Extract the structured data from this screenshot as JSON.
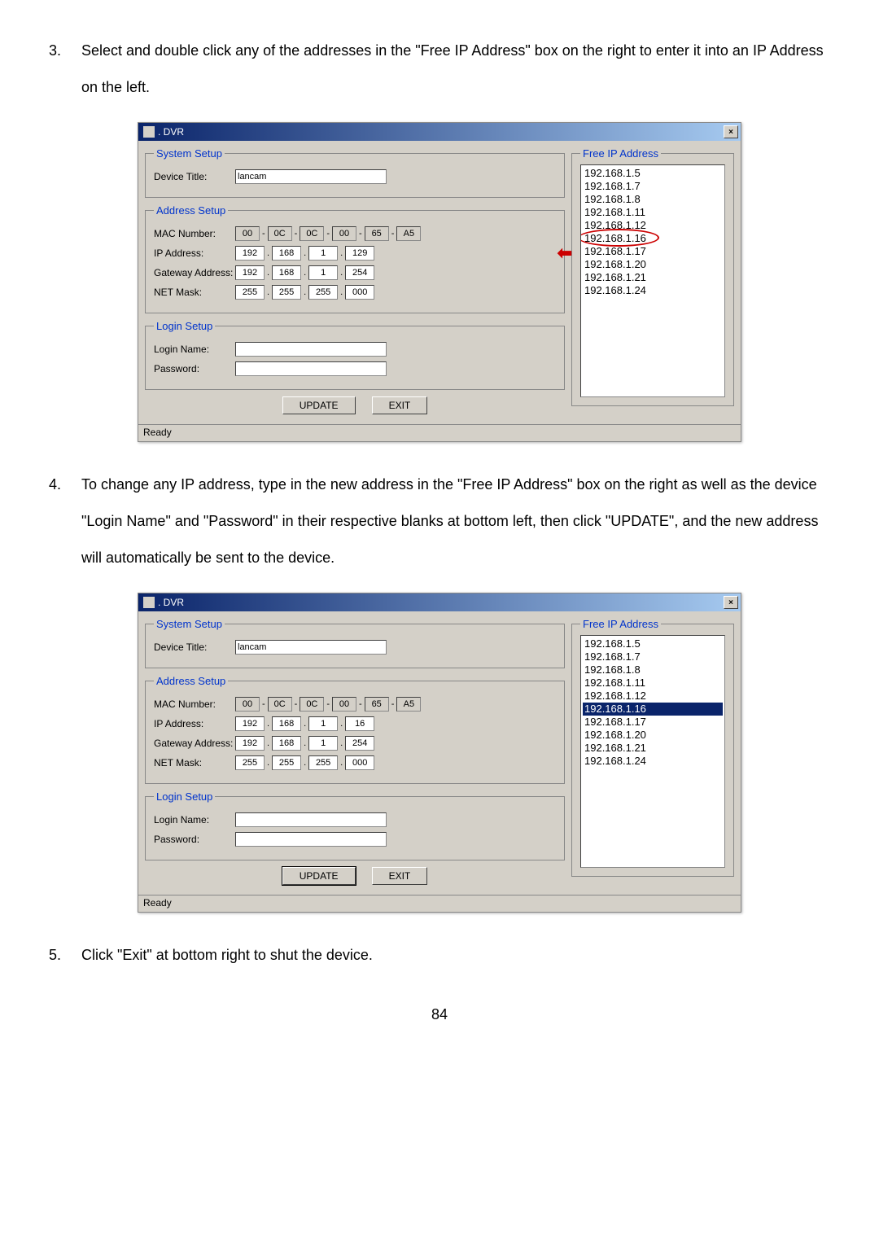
{
  "step3": {
    "num": "3.",
    "text": "Select and double click any of the addresses in the \"Free IP Address\" box on the right to enter it into an IP Address on the left."
  },
  "step4": {
    "num": "4.",
    "text": "To change any IP address, type in the new address in the \"Free IP Address\" box on the right as well as the device \"Login Name\" and \"Password\" in their respective blanks at bottom left, then click \"UPDATE\", and the new address will automatically be sent to the device."
  },
  "step5": {
    "num": "5.",
    "text": "Click \"Exit\" at bottom right to shut the device."
  },
  "window": {
    "title": ". DVR",
    "close": "×",
    "system_setup_legend": "System Setup",
    "device_title_label": "Device Title:",
    "device_title_value": "lancam",
    "address_setup_legend": "Address Setup",
    "mac_label": "MAC Number:",
    "mac": [
      "00",
      "0C",
      "0C",
      "00",
      "65",
      "A5"
    ],
    "mac_sep": "-",
    "ip_label": "IP Address:",
    "gw_label": "Gateway Address:",
    "gw": [
      "192",
      "168",
      "1",
      "254"
    ],
    "mask_label": "NET Mask:",
    "mask": [
      "255",
      "255",
      "255",
      "000"
    ],
    "dot": ".",
    "login_setup_legend": "Login Setup",
    "login_name_label": "Login Name:",
    "password_label": "Password:",
    "update_btn": "UPDATE",
    "exit_btn": "EXIT",
    "free_ip_legend": "Free IP Address",
    "status": "Ready"
  },
  "shot1": {
    "ip": [
      "192",
      "168",
      "1",
      "129"
    ],
    "ips": [
      "192.168.1.5",
      "192.168.1.7",
      "192.168.1.8",
      "192.168.1.11",
      "192.168.1.12",
      "192.168.1.16",
      "192.168.1.17",
      "192.168.1.20",
      "192.168.1.21",
      "192.168.1.24"
    ]
  },
  "shot2": {
    "ip": [
      "192",
      "168",
      "1",
      "16"
    ],
    "ips": [
      "192.168.1.5",
      "192.168.1.7",
      "192.168.1.8",
      "192.168.1.11",
      "192.168.1.12",
      "192.168.1.16",
      "192.168.1.17",
      "192.168.1.20",
      "192.168.1.21",
      "192.168.1.24"
    ]
  },
  "page_number": "84"
}
